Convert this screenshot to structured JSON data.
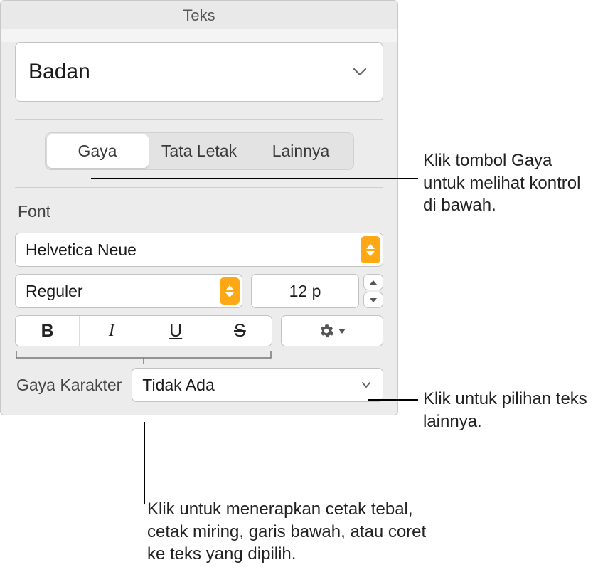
{
  "header": {
    "title": "Teks"
  },
  "paragraph_style": {
    "selected": "Badan"
  },
  "tabs": {
    "items": [
      {
        "label": "Gaya",
        "active": true
      },
      {
        "label": "Tata Letak",
        "active": false
      },
      {
        "label": "Lainnya",
        "active": false
      }
    ]
  },
  "font_section": {
    "label": "Font",
    "family": "Helvetica Neue",
    "weight": "Reguler",
    "size": "12 p",
    "buttons": {
      "bold": "B",
      "italic": "I",
      "underline": "U",
      "strike": "S"
    }
  },
  "character_style": {
    "label": "Gaya Karakter",
    "value": "Tidak Ada"
  },
  "callouts": {
    "gaya_tab": "Klik tombol Gaya untuk melihat kontrol di bawah.",
    "advanced": "Klik untuk pilihan teks lainnya.",
    "style_buttons": "Klik untuk menerapkan cetak tebal, cetak miring, garis bawah, atau coret ke teks yang dipilih."
  }
}
